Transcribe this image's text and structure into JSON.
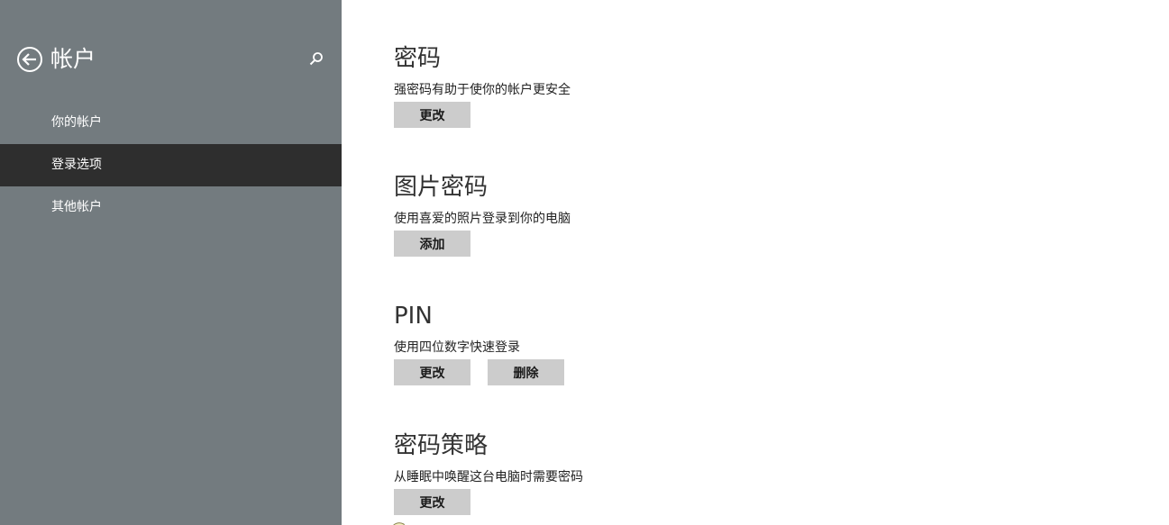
{
  "sidebar": {
    "title": "帐户",
    "back_icon": "back-arrow-circle-icon",
    "search_icon": "search-icon",
    "items": [
      {
        "label": "你的帐户",
        "selected": false
      },
      {
        "label": "登录选项",
        "selected": true
      },
      {
        "label": "其他帐户",
        "selected": false
      }
    ]
  },
  "sections": {
    "password": {
      "title": "密码",
      "desc": "强密码有助于使你的帐户更安全",
      "change_label": "更改"
    },
    "picture_password": {
      "title": "图片密码",
      "desc": "使用喜爱的照片登录到你的电脑",
      "add_label": "添加"
    },
    "pin": {
      "title": "PIN",
      "desc": "使用四位数字快速登录",
      "change_label": "更改",
      "remove_label": "删除"
    },
    "password_policy": {
      "title": "密码策略",
      "desc": "从睡眠中唤醒这台电脑时需要密码",
      "change_label": "更改"
    }
  },
  "colors": {
    "sidebar_bg": "#737b7f",
    "selected_bg": "#2e2e2e",
    "button_bg": "#cccccc"
  }
}
